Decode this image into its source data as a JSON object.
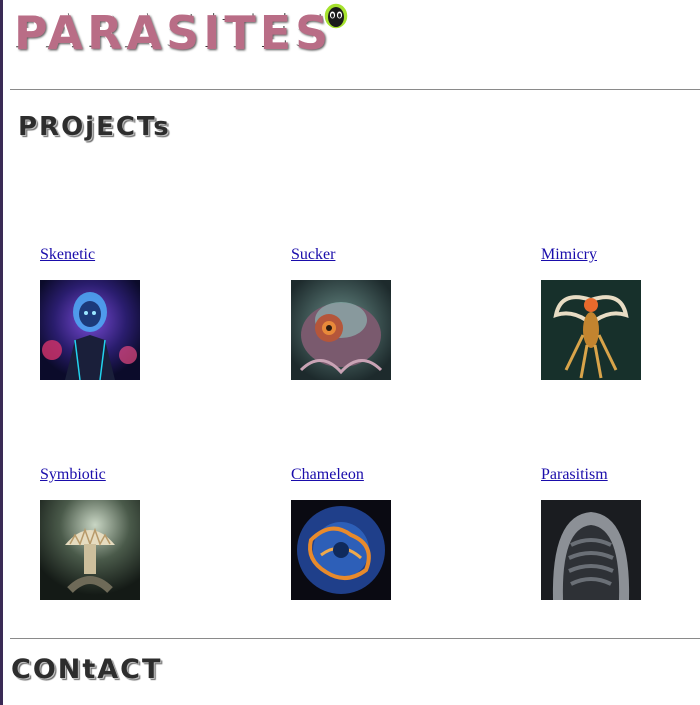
{
  "site": {
    "logo_text": "PARASITES",
    "logo_icon": "alien-head-icon"
  },
  "sections": {
    "projects_heading": "PROjECTs",
    "contact_heading": "CONtACT"
  },
  "projects": [
    {
      "label": "Skenetic",
      "image": "alien-portrait-image"
    },
    {
      "label": "Sucker",
      "image": "sucker-creature-image"
    },
    {
      "label": "Mimicry",
      "image": "mimicry-creature-image"
    },
    {
      "label": "Symbiotic",
      "image": "symbiotic-fungus-image"
    },
    {
      "label": "Chameleon",
      "image": "chameleon-creature-image"
    },
    {
      "label": "Parasitism",
      "image": "parasitism-worm-image"
    }
  ],
  "colors": {
    "link": "#1a0dab",
    "rule": "#8a8a8a",
    "alien_accent": "#a6e22e"
  }
}
